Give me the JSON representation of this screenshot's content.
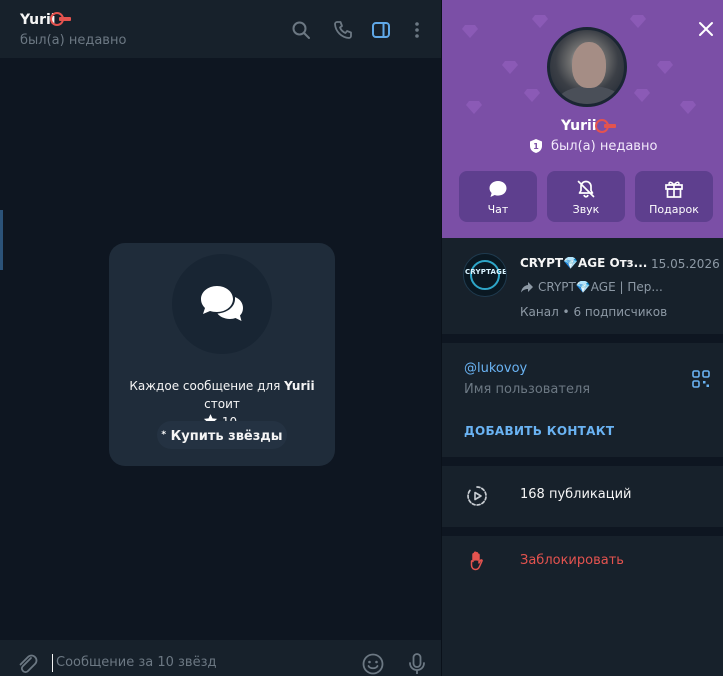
{
  "chat": {
    "name": "Yurii",
    "status": "был(а) недавно",
    "paid_notice_prefix": "Каждое сообщение для ",
    "paid_notice_name": "Yurii",
    "paid_notice_suffix": " стоит",
    "paid_notice_amount": "10.",
    "buy_stars_label": "Купить звёзды",
    "composer_placeholder": "Сообщение за 10 звёзд"
  },
  "profile": {
    "name": "Yurii",
    "status": "был(а) недавно",
    "actions": [
      {
        "label": "Чат",
        "icon": "chat-bubble-icon"
      },
      {
        "label": "Звук",
        "icon": "bell-muted-icon"
      },
      {
        "label": "Подарок",
        "icon": "gift-icon"
      }
    ],
    "channel": {
      "avatar_text": "CRYPTAGE",
      "title": "CRYPT💎AGE Отз...",
      "date": "15.05.2026",
      "preview": "CRYPT💎AGE | Пер...",
      "subtitle": "Канал • 6 подписчиков"
    },
    "username": "@lukovoy",
    "username_label": "Имя пользователя",
    "add_contact_label": "ДОБАВИТЬ КОНТАКТ",
    "posts_label": "168 публикаций",
    "block_label": "Заблокировать"
  },
  "colors": {
    "accent": "#6ab3f3",
    "danger": "#e4534f",
    "header_purple": "#7b4fa6",
    "chat_bg": "#0e1621",
    "panel_bg": "#17212b"
  }
}
